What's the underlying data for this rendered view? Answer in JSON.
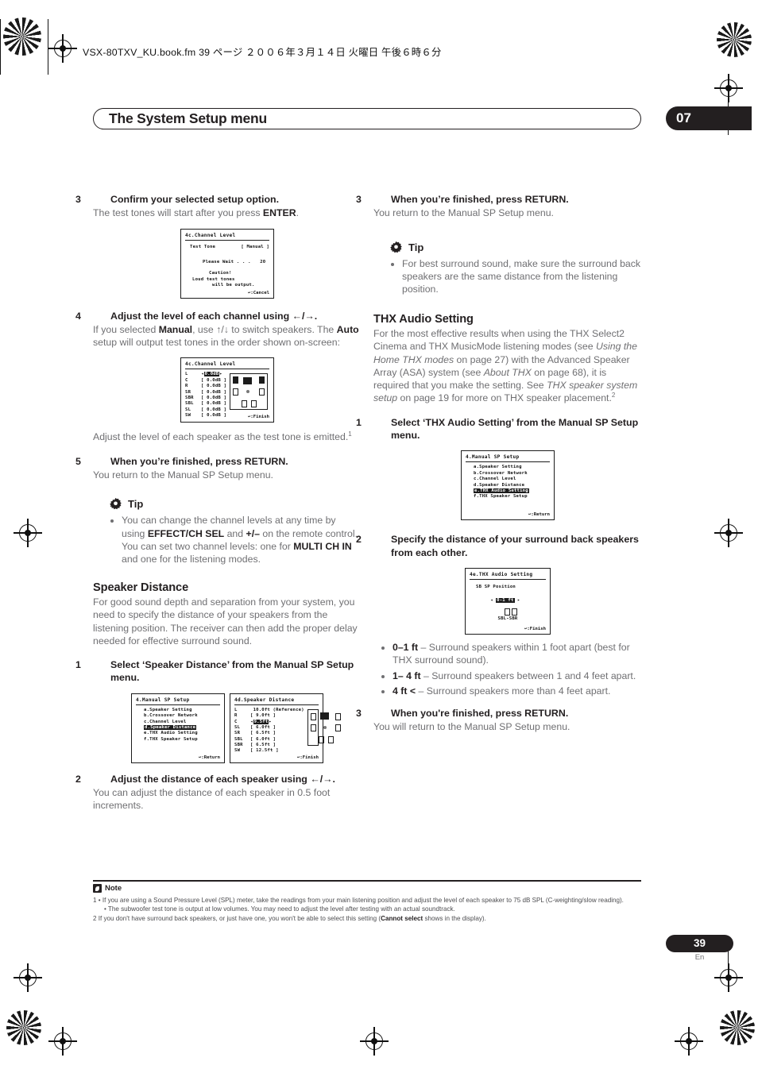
{
  "header": {
    "filmstrip": "VSX-80TXV_KU.book.fm 39 ページ  ２００６年３月１４日   火曜日   午後６時６分",
    "chapter_title": "The System Setup menu",
    "chapter_number": "07"
  },
  "left_column": {
    "step3": {
      "number": "3",
      "heading": "Confirm your selected setup option.",
      "body_1": "The test tones will start after you press ",
      "body_bold": "ENTER",
      "body_2": "."
    },
    "osd_test_tone": {
      "title": "4c.Channel  Level",
      "row_label": "Test  Tone",
      "row_value": "[ Manual ]",
      "wait": "Please  Wait . . .",
      "wait_count": "20",
      "caution": "Caution!",
      "caution_line2": "Loud  test  tones",
      "caution_line3": "will  be  output.",
      "footer": "↩:Cancel"
    },
    "step4": {
      "number": "4",
      "heading": "Adjust the level of each channel using ←/→.",
      "body": "If you selected Manual, use ↑/↓ to switch speakers. The Auto setup will output test tones in the order shown on-screen:",
      "bold_1": "Manual",
      "bold_2": "Auto"
    },
    "osd_channel_level": {
      "title": "4c.Channel  Level",
      "footer": "↩:Finish",
      "rows": [
        {
          "name": "L",
          "value": "0.0dB",
          "selected": true
        },
        {
          "name": "C",
          "value": "0.0dB",
          "selected": false
        },
        {
          "name": "R",
          "value": "0.0dB",
          "selected": false
        },
        {
          "name": "SR",
          "value": "0.0dB",
          "selected": false
        },
        {
          "name": "SBR",
          "value": "0.0dB",
          "selected": false
        },
        {
          "name": "SBL",
          "value": "0.0dB",
          "selected": false
        },
        {
          "name": "SL",
          "value": "0.0dB",
          "selected": false
        },
        {
          "name": "SW",
          "value": "0.0dB",
          "selected": false
        }
      ]
    },
    "after_osd_text": "Adjust the level of each speaker as the test tone is emitted.",
    "after_osd_sup": "1",
    "step5": {
      "number": "5",
      "heading": "When you’re finished, press RETURN.",
      "body": "You return to the Manual SP Setup menu."
    },
    "tip": {
      "label": "Tip",
      "items": [
        "You can change the channel levels at any time by using EFFECT/CH SEL and +/– on the remote control. You can set two channel levels: one for MULTI CH IN and one for the listening modes."
      ],
      "bold_terms": [
        "EFFECT/CH SEL",
        "+/–",
        "MULTI CH IN"
      ]
    },
    "speaker_distance": {
      "heading": "Speaker Distance",
      "body": "For good sound depth and separation from your system, you need to specify the distance of your speakers from the listening position. The receiver can then add the proper delay needed for effective surround sound.",
      "step1_number": "1",
      "step1_heading": "Select ‘Speaker Distance’ from the Manual SP Setup menu."
    },
    "osd_manual_sp_setup_distance": {
      "title": "4.Manual  SP  Setup",
      "footer": "↩:Return",
      "items": [
        {
          "label": "a.Speaker  Setting",
          "selected": false
        },
        {
          "label": "b.Crossover  Network",
          "selected": false
        },
        {
          "label": "c.Channel  Level",
          "selected": false
        },
        {
          "label": "d.Speaker  Distance",
          "selected": true
        },
        {
          "label": "e.THX Audio Setting",
          "selected": false
        },
        {
          "label": "f.THX Speaker Setup",
          "selected": false
        }
      ]
    },
    "osd_speaker_distance": {
      "title": "4d.Speaker  Distance",
      "footer": "↩:Finish",
      "rows": [
        {
          "name": "L",
          "value": "10.0ft (Reference)",
          "selected": false,
          "bracket": false
        },
        {
          "name": "R",
          "value": "9.0ft",
          "selected": false,
          "bracket": true
        },
        {
          "name": "C",
          "value": "9.5ft",
          "selected": true,
          "bracket": true
        },
        {
          "name": "SL",
          "value": "6.0ft",
          "selected": false,
          "bracket": true
        },
        {
          "name": "SR",
          "value": "6.5ft",
          "selected": false,
          "bracket": true
        },
        {
          "name": "SBL",
          "value": "6.0ft",
          "selected": false,
          "bracket": true
        },
        {
          "name": "SBR",
          "value": "6.5ft",
          "selected": false,
          "bracket": true
        },
        {
          "name": "SW",
          "value": "12.5ft",
          "selected": false,
          "bracket": true
        }
      ]
    },
    "step2": {
      "number": "2",
      "heading": "Adjust the distance of each speaker using ←/→.",
      "body": "You can adjust the distance of each speaker in 0.5 foot increments."
    }
  },
  "right_column": {
    "step3": {
      "number": "3",
      "heading": "When you’re finished, press RETURN.",
      "body": "You return to the Manual SP Setup menu."
    },
    "tip": {
      "label": "Tip",
      "items": [
        "For best surround sound, make sure the surround back speakers are the same distance from the listening position."
      ]
    },
    "thx_audio": {
      "heading": "THX Audio Setting",
      "body_part1": "For the most effective results when using the THX Select2 Cinema and THX MusicMode listening modes (see ",
      "body_italic1": "Using the Home THX modes",
      "body_part2": " on page 27) with the Advanced Speaker Array (ASA) system (see ",
      "body_italic2": "About THX",
      "body_part3": " on page 68), it is required that you make the setting. See ",
      "body_italic3": "THX speaker system setup",
      "body_part4": " on page 19 for more on THX speaker placement.",
      "sup": "2",
      "step1_number": "1",
      "step1_heading": "Select ‘THX Audio Setting’ from the Manual SP Setup menu."
    },
    "osd_manual_sp_setup_thx": {
      "title": "4.Manual  SP  Setup",
      "footer": "↩:Return",
      "items": [
        {
          "label": "a.Speaker  Setting",
          "selected": false
        },
        {
          "label": "b.Crossover  Network",
          "selected": false
        },
        {
          "label": "c.Channel  Level",
          "selected": false
        },
        {
          "label": "d.Speaker  Distance",
          "selected": false
        },
        {
          "label": "e.THX Audio Setting",
          "selected": true
        },
        {
          "label": "f.THX Speaker Setup",
          "selected": false
        }
      ]
    },
    "step2": {
      "number": "2",
      "heading": "Specify the distance of your surround back speakers from each other."
    },
    "osd_thx_audio": {
      "title": "4e.THX  Audio  Setting",
      "subtitle": "SB  SP  Position",
      "value": "0-1 ft",
      "speakers_label": "SBL-SBR",
      "footer": "↩:Finish"
    },
    "distance_options": [
      {
        "term": "0–1 ft",
        "desc": " – Surround speakers within 1 foot apart (best for THX surround sound)."
      },
      {
        "term": "1– 4 ft",
        "desc": " – Surround speakers between 1 and 4 feet apart."
      },
      {
        "term": "4 ft <",
        "desc": " – Surround speakers more than 4 feet apart."
      }
    ],
    "step3b": {
      "number": "3",
      "heading": "When you're finished, press RETURN.",
      "body": "You will return to the Manual SP Setup menu."
    }
  },
  "notes": {
    "title": "Note",
    "note1": "1 • If you are using a Sound Pressure Level (SPL) meter, take the readings from your main listening position and adjust the level of each speaker to 75 dB SPL (C-weighting/slow reading).",
    "note1b": "• The subwoofer test tone is output at low volumes. You may need to adjust the level after testing with an actual soundtrack.",
    "note2_part1": "2 If you don't have surround back speakers, or just have one, you won't be able to select this setting (",
    "note2_bold": "Cannot select",
    "note2_part2": " shows in the display)."
  },
  "footer": {
    "page_number": "39",
    "language": "En"
  },
  "colors": {
    "ink": "#231f20",
    "body_gray": "#6f6f72"
  }
}
